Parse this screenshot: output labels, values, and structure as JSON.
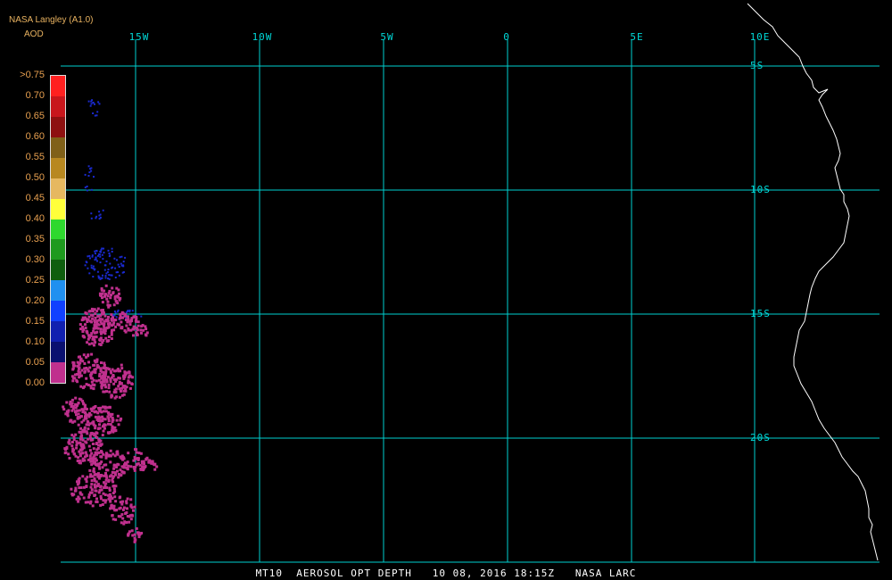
{
  "header": {
    "source": "NASA Langley (A1.0)",
    "variable": "AOD"
  },
  "legend": {
    "labels": [
      ">0.75",
      "0.70",
      "0.65",
      "0.60",
      "0.55",
      "0.50",
      "0.45",
      "0.40",
      "0.35",
      "0.30",
      "0.25",
      "0.20",
      "0.15",
      "0.10",
      "0.05",
      "0.00"
    ],
    "colors": [
      "#ff2020",
      "#c8161c",
      "#8e1010",
      "#806018",
      "#b88820",
      "#e6b860",
      "#ffff3a",
      "#2ed82e",
      "#1e9a1e",
      "#0e5e0e",
      "#2090f0",
      "#1040ff",
      "#1020b0",
      "#0a1070",
      "#c0308e"
    ]
  },
  "longitude_labels": [
    "15W",
    "10W",
    "5W",
    "0",
    "5E",
    "10E"
  ],
  "latitude_labels": [
    "5S",
    "10S",
    "15S",
    "20S"
  ],
  "footer": "MT10  AEROSOL OPT DEPTH   10 08, 2016 18:15Z   NASA LARC",
  "colors": {
    "grid": "#00d0d0",
    "coastline": "#ffffff",
    "aod_low": "#c0308e",
    "aod_010": "#1a2ad0",
    "header_text": "#e8b260"
  }
}
